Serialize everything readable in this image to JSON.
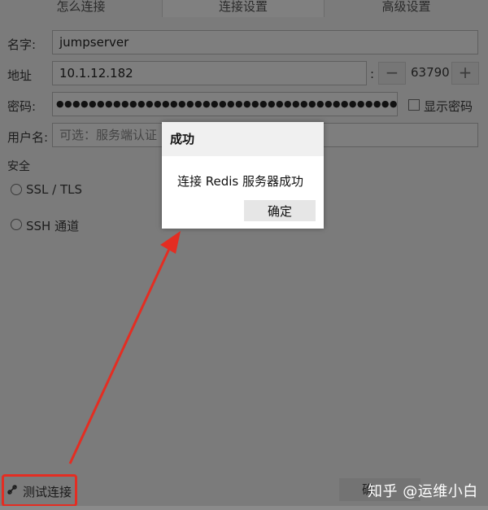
{
  "tabs": [
    {
      "label": "怎么连接"
    },
    {
      "label": "连接设置"
    },
    {
      "label": "高级设置"
    }
  ],
  "form": {
    "name_label": "名字:",
    "name_value": "jumpserver",
    "address_label": "地址",
    "address_value": "10.1.12.182",
    "port_separator": ":",
    "port_value": "63790",
    "port_minus": "−",
    "port_plus": "+",
    "password_label": "密码:",
    "password_masked": "●●●●●●●●●●●●●●●●●●●●●●●●●●●●●●●●●●●●●●●●●●●●●●●●●●●●",
    "show_password_label": "显示密码",
    "username_label": "用户名:",
    "username_placeholder": "可选：服务端认证"
  },
  "security": {
    "heading": "安全",
    "options": [
      {
        "label": "SSL / TLS"
      },
      {
        "label": "SSH 通道"
      }
    ]
  },
  "dialog": {
    "title": "成功",
    "message": "连接 Redis 服务器成功",
    "ok_label": "确定"
  },
  "bottom": {
    "test_connection_label": "测试连接",
    "right_button_label": "确"
  },
  "watermark": "知乎 @运维小白",
  "colors": {
    "highlight": "#e42d22",
    "overlay": "#7b7b7b"
  }
}
